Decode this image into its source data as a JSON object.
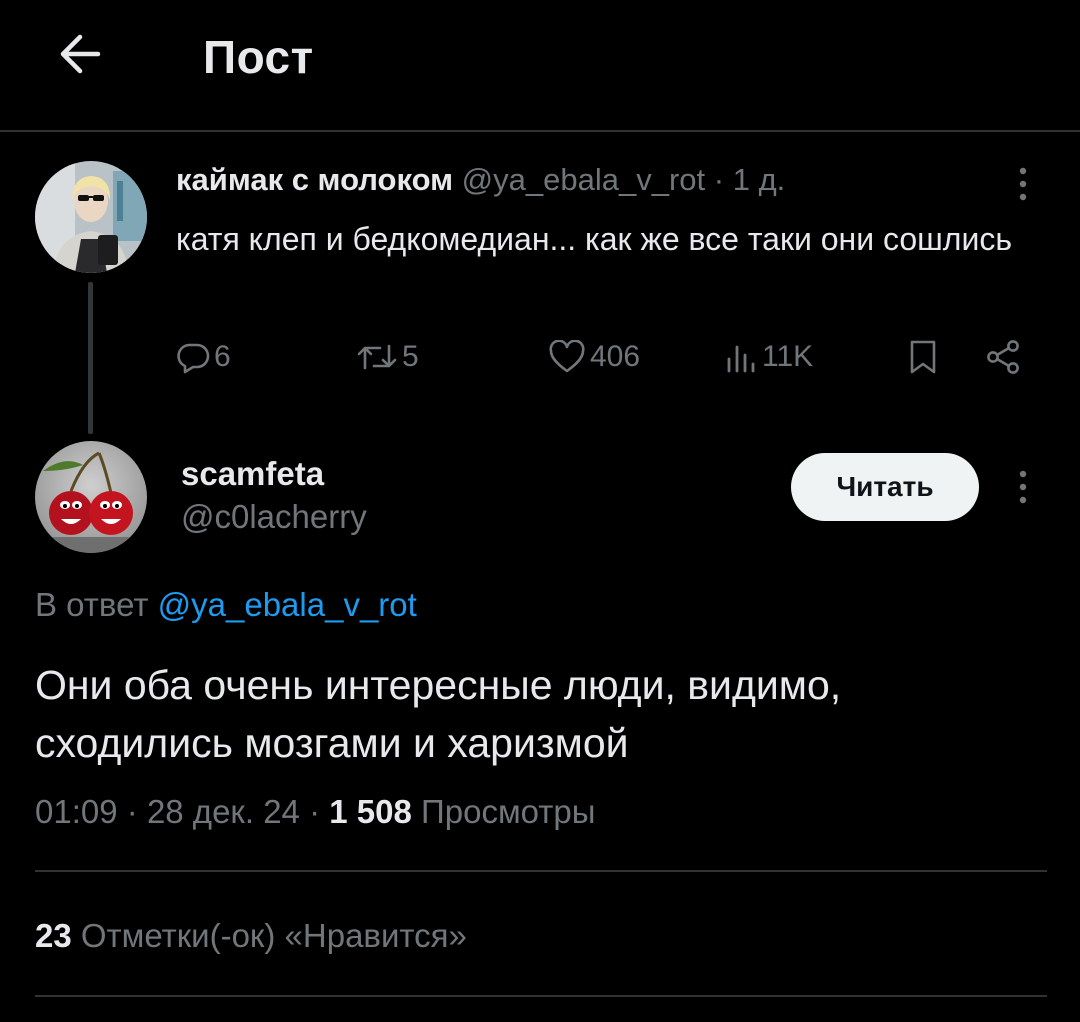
{
  "header": {
    "title": "Пост"
  },
  "parent": {
    "author_name": "каймак с молоком",
    "handle": "@ya_ebala_v_rot",
    "separator": "·",
    "time": "1 д.",
    "text": "катя клеп и бедкомедиан... как же все таки они сошлись",
    "stats": {
      "replies": "6",
      "reposts": "5",
      "likes": "406",
      "views": "11K"
    }
  },
  "reply": {
    "author_name": "scamfeta",
    "handle": "@c0lacherry",
    "follow_label": "Читать",
    "reply_prefix": "В ответ",
    "reply_mention": "@ya_ebala_v_rot",
    "text": "Они оба очень интересные люди, видимо, сходились мозгами и харизмой",
    "time": "01:09",
    "date": "28 дек. 24",
    "separator": "·",
    "views_count": "1 508",
    "views_label": "Просмотры",
    "likes_count": "23",
    "likes_label": "Отметки(-ок) «Нравится»"
  },
  "colors": {
    "background": "#000000",
    "text": "#e7e9ea",
    "secondary": "#71767b",
    "link": "#1d9bf0",
    "divider": "#2f3336",
    "button_bg": "#eff3f4"
  },
  "icons": {
    "back": "arrow-left-icon",
    "more": "more-vertical-icon",
    "reply": "comment-icon",
    "repost": "repost-icon",
    "like": "heart-icon",
    "views": "bar-chart-icon",
    "bookmark": "bookmark-icon",
    "share": "share-icon"
  }
}
